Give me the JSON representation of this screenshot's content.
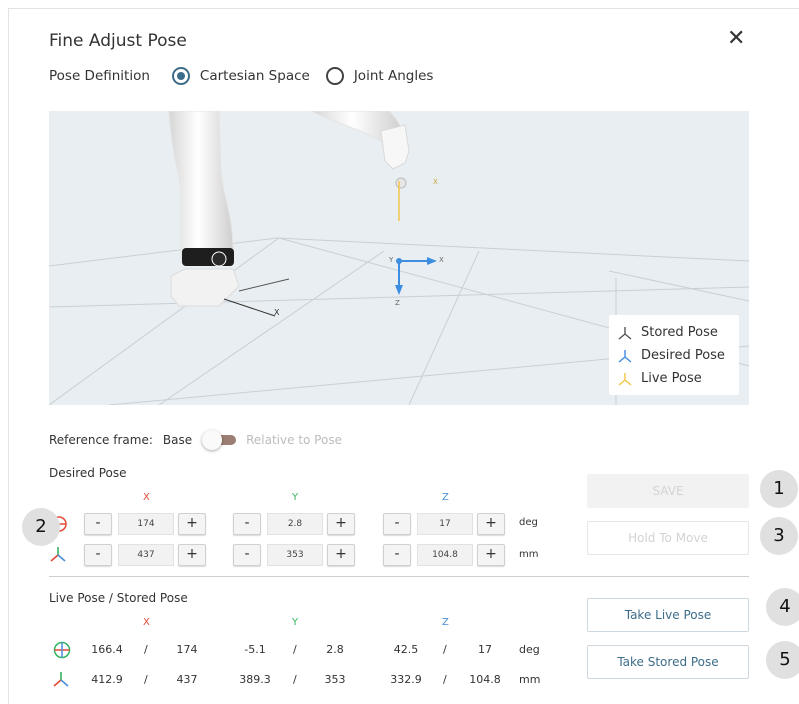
{
  "dialog": {
    "title": "Fine Adjust Pose",
    "close_icon": "close-icon"
  },
  "pose_definition": {
    "label": "Pose Definition",
    "options": [
      {
        "label": "Cartesian Space",
        "selected": true
      },
      {
        "label": "Joint Angles",
        "selected": false
      }
    ]
  },
  "legend": {
    "items": [
      {
        "label": "Stored Pose",
        "color": "#555555"
      },
      {
        "label": "Desired Pose",
        "color": "#3d8de0"
      },
      {
        "label": "Live Pose",
        "color": "#f3c64a"
      }
    ]
  },
  "viewport": {
    "labels": {
      "x1": "X",
      "y_small": "Y",
      "x_small": "X",
      "z_small": "Z",
      "x_live": "X"
    }
  },
  "reference_frame": {
    "label": "Reference frame:",
    "base": "Base",
    "relative": "Relative to Pose"
  },
  "desired_pose": {
    "label": "Desired Pose",
    "axes": [
      "X",
      "Y",
      "Z"
    ],
    "rows": [
      {
        "icon": "rotation-icon",
        "values": [
          "174",
          "2.8",
          "17"
        ],
        "unit": "deg"
      },
      {
        "icon": "translation-icon",
        "values": [
          "437",
          "353",
          "104.8"
        ],
        "unit": "mm"
      }
    ],
    "minus": "-",
    "plus": "+"
  },
  "live_stored": {
    "label": "Live Pose / Stored Pose",
    "axes": [
      "X",
      "Y",
      "Z"
    ],
    "rows": [
      {
        "icon": "rotation-icon",
        "live": [
          "166.4",
          "-5.1",
          "42.5"
        ],
        "stored": [
          "174",
          "2.8",
          "17"
        ],
        "unit": "deg"
      },
      {
        "icon": "translation-icon",
        "live": [
          "412.9",
          "389.3",
          "332.9"
        ],
        "stored": [
          "437",
          "353",
          "104.8"
        ],
        "unit": "mm"
      }
    ],
    "separator": "/"
  },
  "buttons": {
    "save": "SAVE",
    "hold": "Hold To Move",
    "take_live": "Take Live Pose",
    "take_stored": "Take Stored Pose"
  },
  "badges": [
    "1",
    "2",
    "3",
    "4",
    "5"
  ],
  "colors": {
    "accent": "#3d6d8a",
    "x": "#e04a3a",
    "y": "#34b560",
    "z": "#4a8fd6"
  }
}
